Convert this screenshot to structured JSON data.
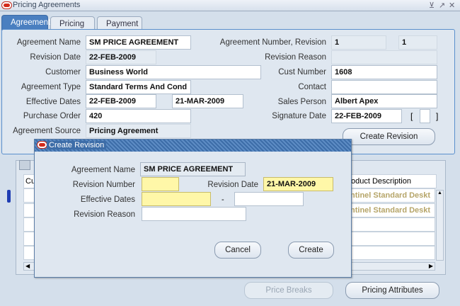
{
  "window": {
    "title": "Pricing Agreements",
    "controls": [
      "⊻",
      "↗",
      "✕"
    ]
  },
  "tabs": [
    {
      "label": "Agreement",
      "active": true
    },
    {
      "label": "Pricing",
      "active": false
    },
    {
      "label": "Payment",
      "active": false
    }
  ],
  "form": {
    "agreement_name_label": "Agreement Name",
    "agreement_name": "SM PRICE AGREEMENT",
    "agreement_number_label": "Agreement Number, Revision",
    "agreement_number": "1",
    "revision": "1",
    "revision_date_label": "Revision Date",
    "revision_date": "22-FEB-2009",
    "revision_reason_label": "Revision Reason",
    "revision_reason": "",
    "customer_label": "Customer",
    "customer": "Business World",
    "cust_number_label": "Cust Number",
    "cust_number": "1608",
    "agreement_type_label": "Agreement Type",
    "agreement_type": "Standard Terms And Cond",
    "contact_label": "Contact",
    "contact": "",
    "effective_dates_label": "Effective Dates",
    "effective_from": "22-FEB-2009",
    "effective_to": "21-MAR-2009",
    "sales_person_label": "Sales Person",
    "sales_person": "Albert Apex",
    "purchase_order_label": "Purchase Order",
    "purchase_order": "420",
    "signature_date_label": "Signature Date",
    "signature_date": "22-FEB-2009",
    "sig_bracket_open": "[",
    "sig_bracket_close": "]",
    "agreement_source_label": "Agreement Source",
    "agreement_source": "Pricing Agreement",
    "create_revision_button": "Create Revision"
  },
  "grid": {
    "col_customer_header": "Cu",
    "col_product_header": "oduct Description",
    "rows": [
      "ntinel Standard Deskt",
      "ntinel Standard Deskt"
    ]
  },
  "bottom_buttons": {
    "price_breaks": "Price Breaks",
    "pricing_attributes": "Pricing Attributes"
  },
  "dialog": {
    "title": "Create Revision",
    "agreement_name_label": "Agreement Name",
    "agreement_name": "SM PRICE AGREEMENT",
    "revision_number_label": "Revision Number",
    "revision_number": "",
    "revision_date_label": "Revision Date",
    "revision_date": "21-MAR-2009",
    "effective_dates_label": "Effective Dates",
    "effective_from": "",
    "effective_sep": "-",
    "effective_to": "",
    "revision_reason_label": "Revision Reason",
    "revision_reason": "",
    "cancel_button": "Cancel",
    "create_button": "Create"
  }
}
